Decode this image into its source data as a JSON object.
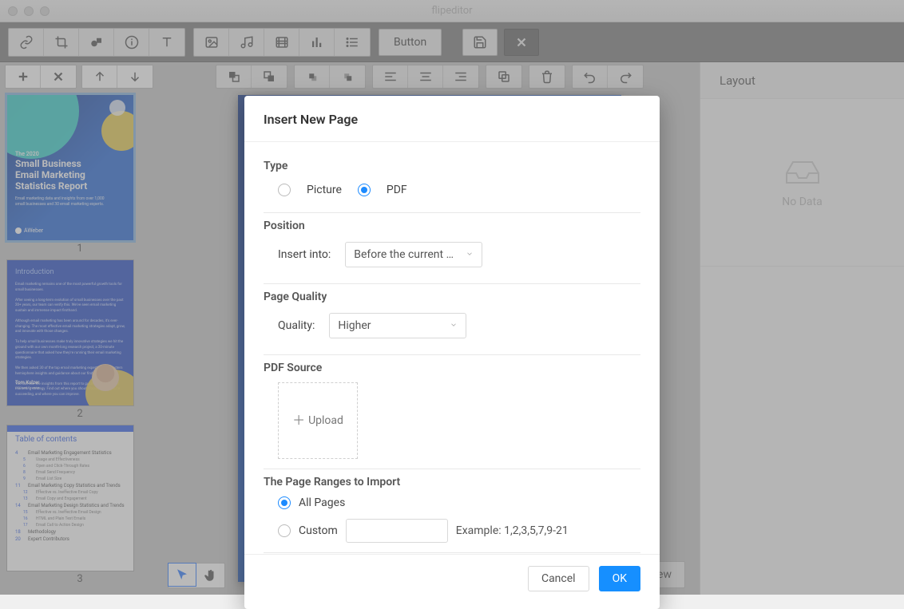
{
  "window": {
    "title": "flipeditor"
  },
  "toolbar": {
    "button_label": "Button"
  },
  "pages_panel": {
    "thumbs": [
      {
        "number": "1",
        "cover_pre": "The 2020",
        "cover_title": "Small Business\nEmail Marketing\nStatistics Report",
        "cover_sub": "Email marketing data and insights from over 1,000 small businesses and 30 email marketing experts.",
        "cover_logo": "AWeber"
      },
      {
        "number": "2",
        "intro_heading": "Introduction",
        "intro_name": "Tom Kulzer",
        "intro_role": "CEO and Founder"
      },
      {
        "number": "3",
        "toc_title": "Table of contents",
        "toc": [
          {
            "pg": "4",
            "txt": "Email Marketing Engagement Statistics",
            "lvl": 1
          },
          {
            "pg": "5",
            "txt": "Usage and Effectiveness",
            "lvl": 2
          },
          {
            "pg": "6",
            "txt": "Open and Click-Through Rates",
            "lvl": 2
          },
          {
            "pg": "8",
            "txt": "Email Send Frequency",
            "lvl": 2
          },
          {
            "pg": "9",
            "txt": "Email List Size",
            "lvl": 2
          },
          {
            "pg": "11",
            "txt": "Email Marketing Copy Statistics and Trends",
            "lvl": 1
          },
          {
            "pg": "12",
            "txt": "Effective vs. Ineffective Email Copy",
            "lvl": 2
          },
          {
            "pg": "13",
            "txt": "Email Copy and Engagement",
            "lvl": 2
          },
          {
            "pg": "14",
            "txt": "Email Marketing Design Statistics and Trends",
            "lvl": 1
          },
          {
            "pg": "15",
            "txt": "Effective vs. Ineffective Email Design",
            "lvl": 2
          },
          {
            "pg": "16",
            "txt": "HTML and Plain Text Emails",
            "lvl": 2
          },
          {
            "pg": "17",
            "txt": "Email Call to Action Design",
            "lvl": 2
          },
          {
            "pg": "18",
            "txt": "Methodology",
            "lvl": 1
          },
          {
            "pg": "20",
            "txt": "Expert Contributors",
            "lvl": 1
          }
        ]
      }
    ]
  },
  "layout_panel": {
    "header": "Layout",
    "empty": "No Data"
  },
  "bottom": {
    "preview": "view"
  },
  "dialog": {
    "title": "Insert New Page",
    "type_label": "Type",
    "type_picture": "Picture",
    "type_pdf": "PDF",
    "position_label": "Position",
    "insert_into_label": "Insert into:",
    "insert_into_value": "Before the current …",
    "quality_section_label": "Page Quality",
    "quality_label": "Quality:",
    "quality_value": "Higher",
    "source_label": "PDF Source",
    "upload_label": "Upload",
    "ranges_label": "The Page Ranges to Import",
    "range_all": "All Pages",
    "range_custom": "Custom",
    "range_example": "Example: 1,2,3,5,7,9-21",
    "cancel": "Cancel",
    "ok": "OK"
  }
}
